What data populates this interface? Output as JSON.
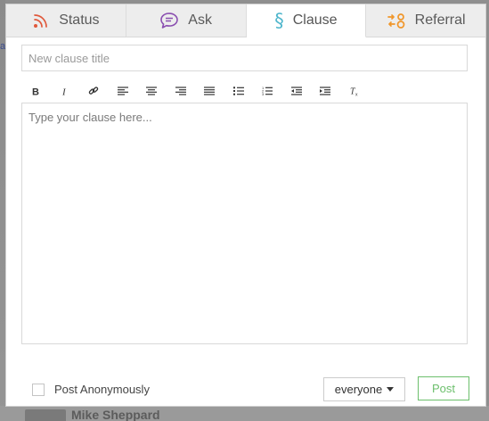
{
  "tabs": [
    {
      "label": "Status",
      "icon": "rss-icon",
      "color": "#e0593c",
      "active": false
    },
    {
      "label": "Ask",
      "icon": "speech-bubble-icon",
      "color": "#8a4fb0",
      "active": false
    },
    {
      "label": "Clause",
      "icon": "section-sign-icon",
      "color": "#4fb6cc",
      "active": true
    },
    {
      "label": "Referral",
      "icon": "referral-icon",
      "color": "#f0962a",
      "active": false
    }
  ],
  "title_input": {
    "placeholder": "New clause title",
    "value": ""
  },
  "toolbar": {
    "buttons": [
      "bold-icon",
      "italic-icon",
      "link-icon",
      "align-left-icon",
      "align-center-icon",
      "align-right-icon",
      "align-justify-icon",
      "bulleted-list-icon",
      "numbered-list-icon",
      "outdent-icon",
      "indent-icon",
      "clear-format-icon"
    ]
  },
  "editor": {
    "placeholder": "Type your clause here...",
    "value": ""
  },
  "footer": {
    "anonymous_label": "Post Anonymously",
    "anonymous_checked": false,
    "audience_value": "everyone",
    "post_label": "Post"
  },
  "colors": {
    "post_green": "#6cbf6c"
  },
  "background": {
    "partial_name": "Mike Sheppard"
  }
}
